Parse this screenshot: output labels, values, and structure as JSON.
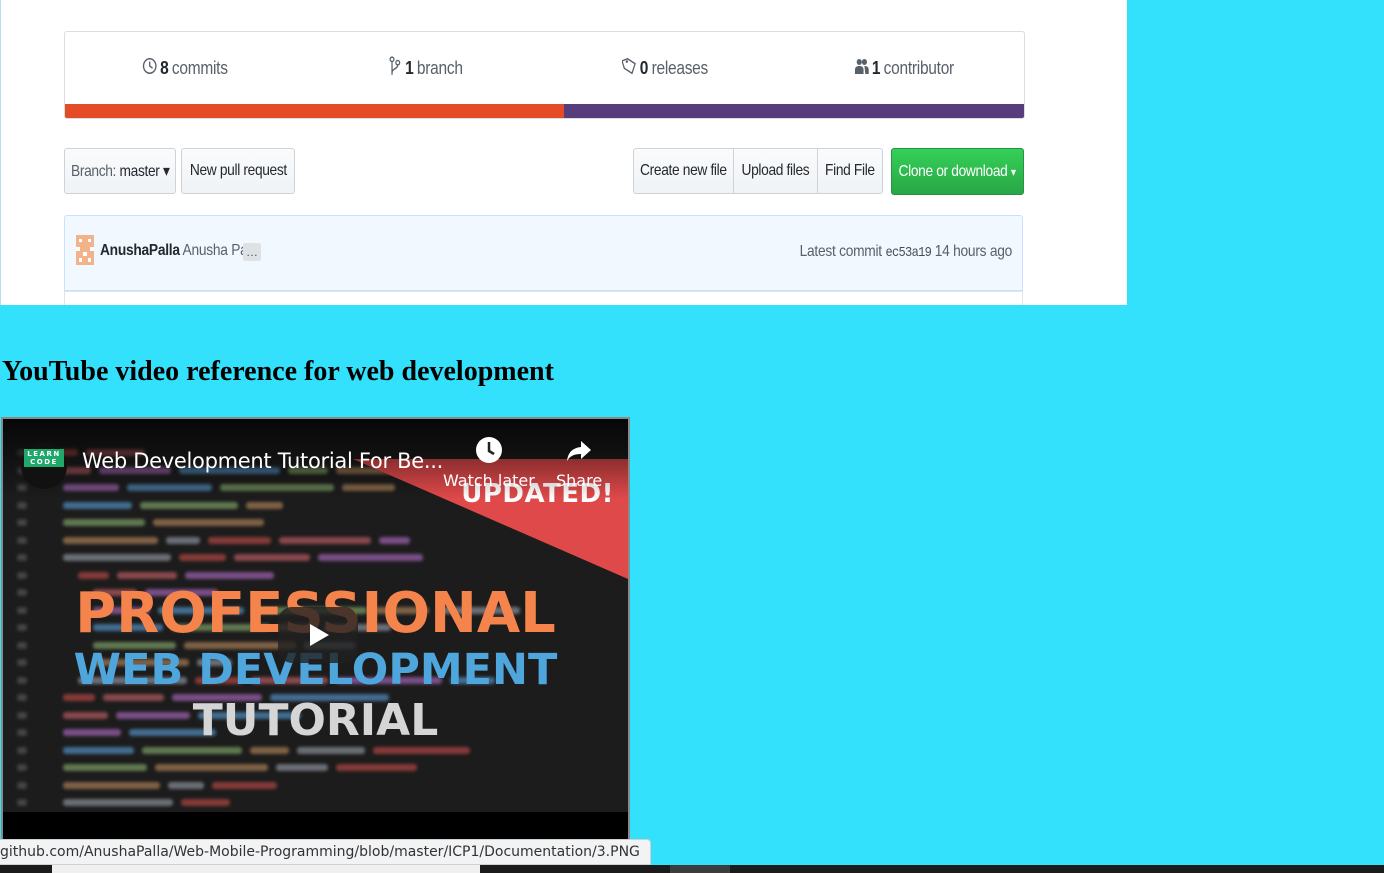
{
  "github": {
    "numbers": [
      {
        "icon": "commits-icon",
        "count": "8",
        "label": "commits"
      },
      {
        "icon": "branch-icon",
        "count": "1",
        "label": "branch"
      },
      {
        "icon": "tag-icon",
        "count": "0",
        "label": "releases"
      },
      {
        "icon": "people-icon",
        "count": "1",
        "label": "contributor"
      }
    ],
    "language_bar": [
      {
        "color": "#e34c26",
        "share": 0.52
      },
      {
        "color": "#563d7c",
        "share": 0.48
      }
    ],
    "branch_button": {
      "prefix": "Branch:",
      "value": "master"
    },
    "new_pull_request": "New pull request",
    "file_buttons": [
      "Create new file",
      "Upload files",
      "Find File"
    ],
    "clone_button": "Clone or download",
    "commit": {
      "username": "AnushaPalla",
      "full_name": "Anusha Palla",
      "ellipsis": "…",
      "latest_label": "Latest commit",
      "sha": "ec53a19",
      "time": "14 hours ago"
    }
  },
  "heading": "YouTube video reference for web development",
  "youtube": {
    "channel_logo_line1": "LEARN",
    "channel_logo_line2": "CODE",
    "title": "Web Development Tutorial For Be...",
    "watch_later": "Watch later",
    "share": "Share",
    "thumbnail_badge": "UPDATED!",
    "thumbnail_line1": "PROFESSIONAL",
    "thumbnail_line2": "WEB DEVELOPMENT",
    "thumbnail_line3": "TUTORIAL",
    "play_icon": "play-icon"
  },
  "status_bar_url": "github.com/AnushaPalla/Web-Mobile-Programming/blob/master/ICP1/Documentation/3.PNG",
  "colors": {
    "page_background": "#33e1fc",
    "clone_green": "#28a745",
    "thumbnail_orange": "#f4844c",
    "thumbnail_blue": "#4ea6dc",
    "banner_red": "#e0494a"
  }
}
